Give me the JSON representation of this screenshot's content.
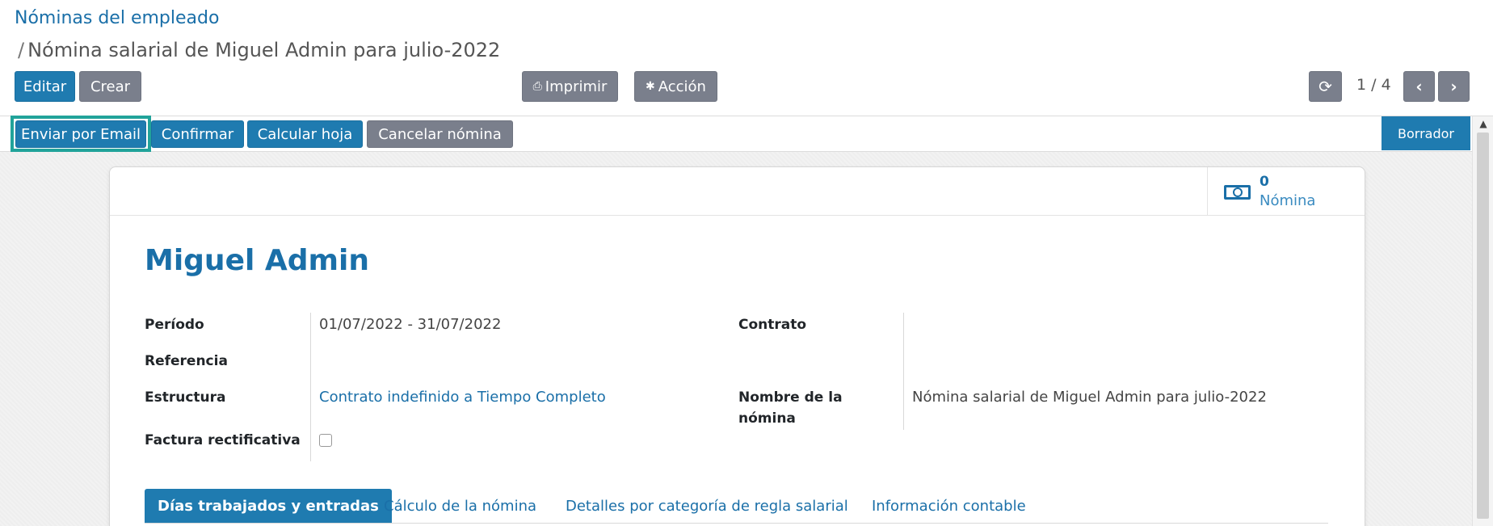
{
  "breadcrumb": {
    "root": "Nóminas del empleado",
    "separator": "/",
    "current": "Nómina salarial de Miguel Admin para julio-2022"
  },
  "toolbar": {
    "edit": "Editar",
    "create": "Crear",
    "print": "Imprimir",
    "action": "Acción",
    "refresh_icon": "refresh-icon",
    "pager": "1 / 4",
    "prev_icon": "chevron-left-icon",
    "next_icon": "chevron-right-icon"
  },
  "statusbar": {
    "send_email": "Enviar por Email",
    "confirm": "Confirmar",
    "compute_sheet": "Calcular hoja",
    "cancel_payslip": "Cancelar nómina",
    "state": "Borrador"
  },
  "smart_button": {
    "count": "0",
    "label": "Nómina",
    "icon": "money-icon"
  },
  "employee": {
    "name": "Miguel Admin"
  },
  "fields": {
    "period_label": "Período",
    "period_value": "01/07/2022 - 31/07/2022",
    "reference_label": "Referencia",
    "reference_value": "",
    "structure_label": "Estructura",
    "structure_value": "Contrato indefinido a Tiempo Completo",
    "refund_label": "Factura rectificativa",
    "refund_checked": false,
    "contract_label": "Contrato",
    "contract_value": "",
    "payslip_name_label_1": "Nombre de la",
    "payslip_name_label_2": "nómina",
    "payslip_name_value": "Nómina salarial de Miguel Admin para julio-2022"
  },
  "tabs": [
    {
      "label": "Días trabajados y entradas",
      "active": true
    },
    {
      "label": "Cálculo de la nómina",
      "active": false
    },
    {
      "label": "Detalles por categoría de regla salarial",
      "active": false
    },
    {
      "label": "Información contable",
      "active": false
    }
  ],
  "colors": {
    "primary": "#1f7bb0",
    "secondary": "#7a7f8c",
    "highlight": "#21a39a"
  }
}
